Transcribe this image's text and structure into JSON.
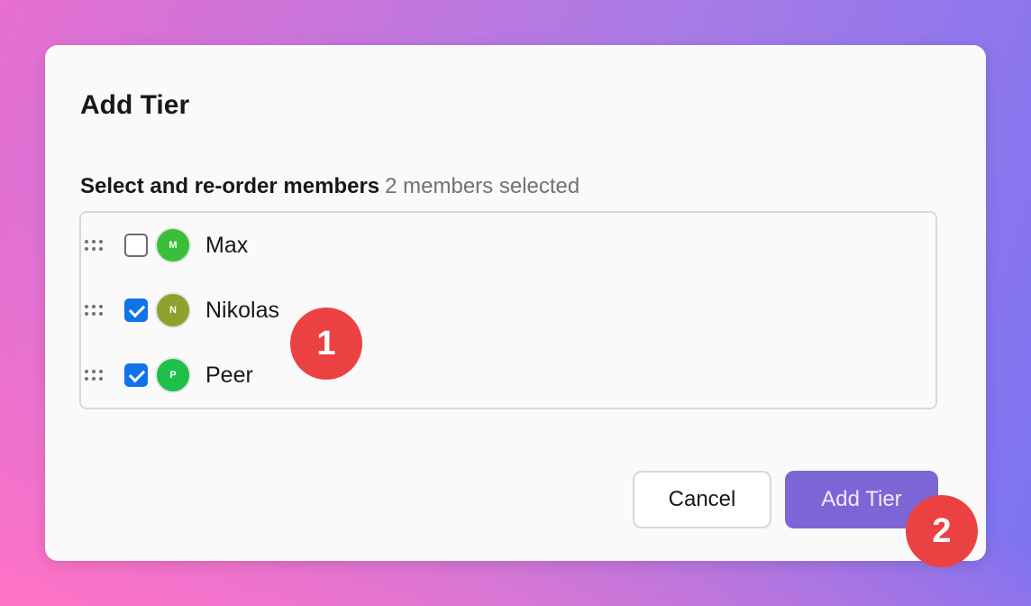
{
  "dialog": {
    "title": "Add Tier",
    "section_label": "Select and re-order members",
    "selection_count": "2 members selected"
  },
  "members": [
    {
      "name": "Max",
      "initial": "M",
      "checked": false,
      "avatar_color": "#3bbf3b"
    },
    {
      "name": "Nikolas",
      "initial": "N",
      "checked": true,
      "avatar_color": "#8da12f"
    },
    {
      "name": "Peer",
      "initial": "P",
      "checked": true,
      "avatar_color": "#1ec04a"
    }
  ],
  "actions": {
    "cancel_label": "Cancel",
    "add_label": "Add Tier"
  },
  "annotations": {
    "marker_1": "1",
    "marker_2": "2"
  },
  "colors": {
    "accent": "#7c66d6",
    "checkbox_checked": "#1173e8",
    "marker": "#ec4142"
  }
}
